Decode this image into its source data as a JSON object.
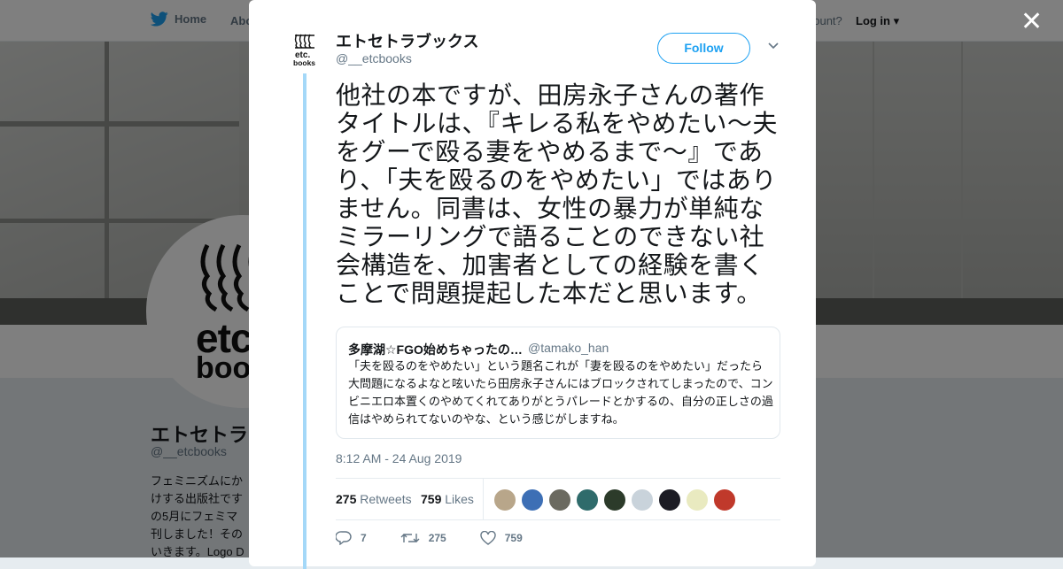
{
  "nav": {
    "home_label": "Home",
    "about_label": "Abo",
    "account_text": "account?",
    "login_label": "Log in"
  },
  "profile": {
    "name": "エトセトラ",
    "handle": "@__etcbooks",
    "bio_lines": [
      "フェミニズムにか",
      "けする出版社です",
      "の5月にフェミマ",
      "刊しました！その",
      "いきます。Logo D"
    ],
    "avatar_text_1": "etc",
    "avatar_text_2": "boo"
  },
  "modal": {
    "author_name": "エトセトラブックス",
    "author_handle": "@__etcbooks",
    "follow_label": "Follow",
    "avatar_text_1": "etc.",
    "avatar_text_2": "books",
    "tweet_text": "他社の本ですが、田房永子さんの著作タイトルは、『キレる私をやめたい〜夫をグーで殴る妻をやめるまで〜』であり、「夫を殴るのをやめたい」ではありません。同書は、女性の暴力が単純なミラーリングで語ることのできない社会構造を、加害者としての経験を書くことで問題提起した本だと思います。",
    "quote": {
      "name": "多摩湖☆FGO始めちゃったの…",
      "handle": "@tamako_han",
      "text": "「夫を殴るのをやめたい」という題名これが「妻を殴るのをやめたい」だったら大問題になるよなと呟いたら田房永子さんにはブロックされてしまったので、コンビニエロ本置くのやめてくれてありがとうパレードとかするの、自分の正しさの過信はやめられてないのやな、という感じがしますね。"
    },
    "timestamp": "8:12 AM - 24 Aug 2019",
    "retweets_count": "275",
    "retweets_label": "Retweets",
    "likes_count": "759",
    "likes_label": "Likes",
    "liker_colors": [
      "#b8a68a",
      "#3d6fb5",
      "#6b6a60",
      "#2f6b6b",
      "#2c3b2a",
      "#c9d3db",
      "#1c1c24",
      "#e9eac0",
      "#c0392b"
    ],
    "actions": {
      "reply_count": "7",
      "retweet_count": "275",
      "like_count": "759"
    }
  },
  "colors": {
    "accent": "#1da1f2",
    "thread_line": "#a4d8f8",
    "muted": "#657786"
  }
}
